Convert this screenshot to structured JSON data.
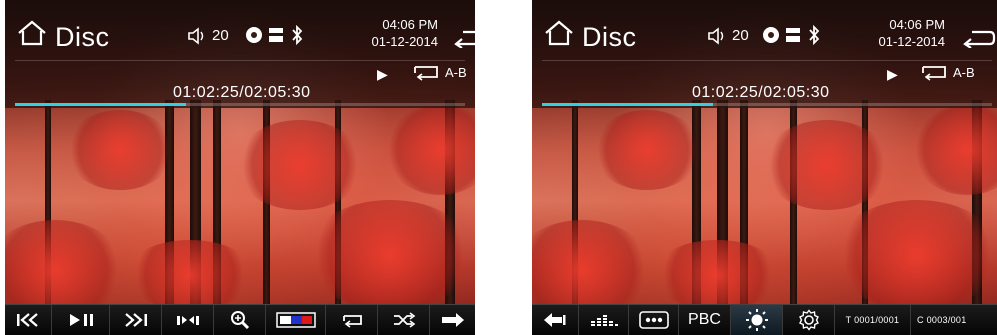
{
  "screens": [
    {
      "title": "Disc",
      "volume": "20",
      "time": "04:06 PM",
      "date": "01-12-2014",
      "ab_label": "A-B",
      "playback_time": "01:02:25/02:05:30",
      "progress": 0.38,
      "toolbar": [
        "previous-icon",
        "play-pause-icon",
        "next-icon",
        "audio-icon",
        "zoom-icon",
        "color-settings-icon",
        "repeat-icon",
        "shuffle-icon",
        "next-page-icon"
      ]
    },
    {
      "title": "Disc",
      "volume": "20",
      "time": "04:06 PM",
      "date": "01-12-2014",
      "ab_label": "A-B",
      "playback_time": "01:02:25/02:05:30",
      "progress": 0.38,
      "toolbar": {
        "pbc_label": "PBC",
        "title_counter": "T 0001/0001",
        "chapter_counter": "C 0003/001"
      }
    }
  ],
  "colors": {
    "progress": "#35d0e0",
    "toolbar_bg": "#0a0a0a",
    "header_bg": "#1e0e0a"
  }
}
